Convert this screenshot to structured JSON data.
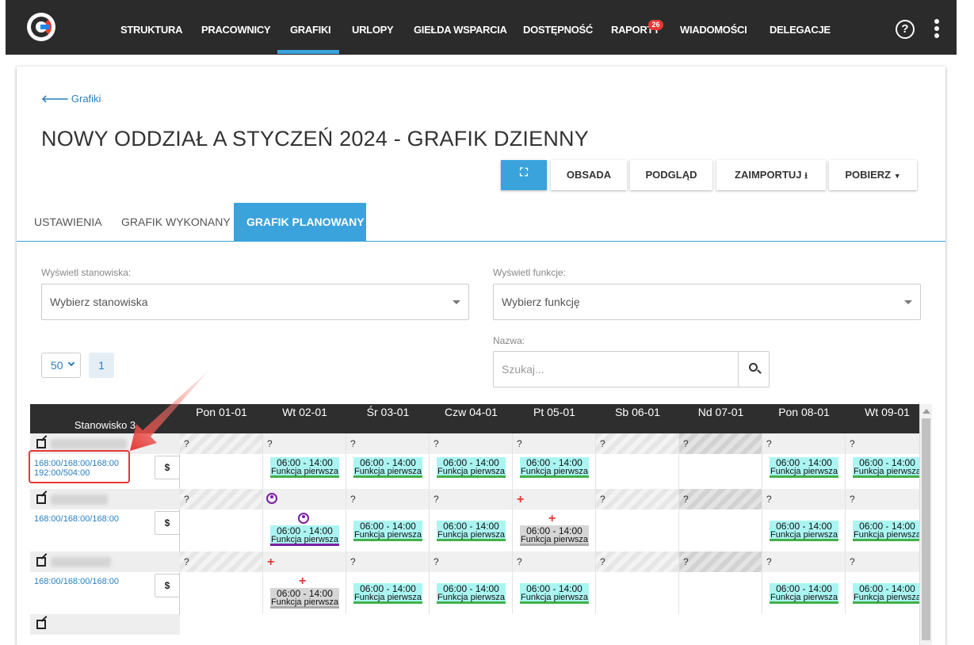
{
  "nav": {
    "items": [
      "STRUKTURA",
      "PRACOWNICY",
      "GRAFIKI",
      "URLOPY",
      "GIEŁDA WSPARCIA",
      "DOSTĘPNOŚĆ",
      "RAPORTY",
      "WIADOMOŚCI",
      "DELEGACJE"
    ],
    "active": "GRAFIKI",
    "raporty_badge": "26",
    "help": "?"
  },
  "page": {
    "back_label": "Grafiki",
    "title": "NOWY ODDZIAŁ A STYCZEŃ 2024 - GRAFIK DZIENNY"
  },
  "toolbar": {
    "obsada": "OBSADA",
    "podglad": "PODGLĄD",
    "zaimportuj": "ZAIMPORTUJ",
    "pobierz": "POBIERZ"
  },
  "tabs": [
    "USTAWIENIA",
    "GRAFIK WYKONANY",
    "GRAFIK PLANOWANY"
  ],
  "filters": {
    "stanowiska_label": "Wyświetl stanowiska:",
    "stanowiska_placeholder": "Wybierz stanowiska",
    "funkcje_label": "Wyświetl funkcje:",
    "funkcje_placeholder": "Wybierz funkcję",
    "nazwa_label": "Nazwa:",
    "search_placeholder": "Szukaj..."
  },
  "pager": {
    "size": "50",
    "page": "1"
  },
  "grid": {
    "stanowisko": "Stanowisko 3",
    "days": [
      "Pon 01-01",
      "Wt 02-01",
      "Śr 03-01",
      "Czw 04-01",
      "Pt 05-01",
      "Sb 06-01",
      "Nd 07-01",
      "Pon 08-01",
      "Wt 09-01"
    ],
    "shift_time": "06:00 - 14:00",
    "shift_function": "Funkcja pierwsza",
    "q": "?",
    "money": "$",
    "employees": [
      {
        "hours_line1": "168:00/168:00/168:00",
        "hours_line2": "192:00/504:00"
      },
      {
        "hours_line1": "168:00/168:00/168:00",
        "hours_line2": ""
      },
      {
        "hours_line1": "168:00/168:00/168:00",
        "hours_line2": ""
      }
    ]
  },
  "colors": {
    "accent": "#3aa3dc",
    "nav_bg": "#2b2b2b",
    "shift_bg": "#aaf5f2",
    "shift_border": "#43b049",
    "alert": "#e53935"
  }
}
